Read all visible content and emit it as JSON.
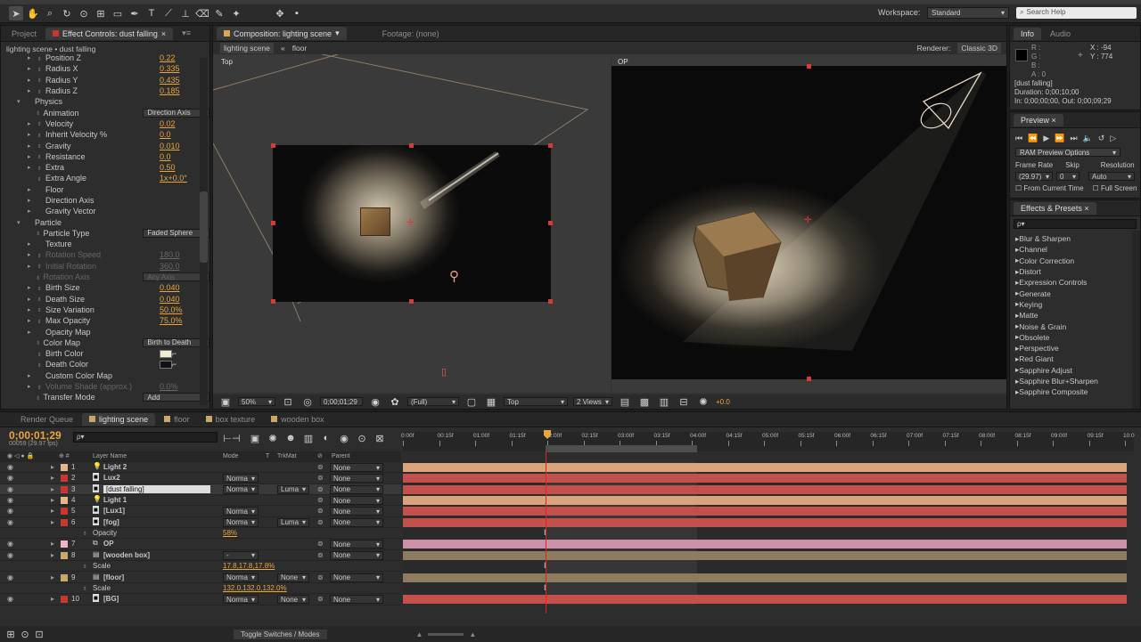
{
  "toolbar": {
    "workspace_label": "Workspace:",
    "workspace_value": "Standard",
    "search_placeholder": "Search Help"
  },
  "effect_controls": {
    "tab_project": "Project",
    "tab_effect": "Effect Controls: dust falling",
    "breadcrumb": "lighting scene • dust falling",
    "rows": [
      {
        "indent": 2,
        "tw": "▸",
        "sw": "♁",
        "name": "Position Z",
        "value": "0.22",
        "dim": false
      },
      {
        "indent": 2,
        "tw": "▸",
        "sw": "♁",
        "name": "Radius X",
        "value": "0.335",
        "dim": false
      },
      {
        "indent": 2,
        "tw": "▸",
        "sw": "♁",
        "name": "Radius Y",
        "value": "0.435",
        "dim": false
      },
      {
        "indent": 2,
        "tw": "▸",
        "sw": "♁",
        "name": "Radius Z",
        "value": "0.185",
        "dim": false
      },
      {
        "indent": 1,
        "tw": "▾",
        "sw": "",
        "name": "Physics",
        "value": "",
        "dim": false
      },
      {
        "indent": 2,
        "tw": "",
        "sw": "♁",
        "name": "Animation",
        "dd": "Direction Axis",
        "dim": false
      },
      {
        "indent": 2,
        "tw": "▸",
        "sw": "♁",
        "name": "Velocity",
        "value": "0.02",
        "dim": false
      },
      {
        "indent": 2,
        "tw": "▸",
        "sw": "♁",
        "name": "Inherit Velocity %",
        "value": "0.0",
        "dim": false
      },
      {
        "indent": 2,
        "tw": "▸",
        "sw": "♁",
        "name": "Gravity",
        "value": "0.010",
        "dim": false
      },
      {
        "indent": 2,
        "tw": "▸",
        "sw": "♁",
        "name": "Resistance",
        "value": "0.0",
        "dim": false
      },
      {
        "indent": 2,
        "tw": "▸",
        "sw": "♁",
        "name": "Extra",
        "value": "0.50",
        "dim": false
      },
      {
        "indent": 2,
        "tw": "",
        "sw": "♁",
        "name": "Extra Angle",
        "value": "1x+0.0°",
        "dim": false
      },
      {
        "indent": 2,
        "tw": "▸",
        "sw": "",
        "name": "Floor",
        "value": "",
        "dim": false
      },
      {
        "indent": 2,
        "tw": "▸",
        "sw": "",
        "name": "Direction Axis",
        "value": "",
        "dim": false
      },
      {
        "indent": 2,
        "tw": "▸",
        "sw": "",
        "name": "Gravity Vector",
        "value": "",
        "dim": false
      },
      {
        "indent": 1,
        "tw": "▾",
        "sw": "",
        "name": "Particle",
        "value": "",
        "dim": false
      },
      {
        "indent": 2,
        "tw": "",
        "sw": "♁",
        "name": "Particle Type",
        "dd": "Faded Sphere",
        "dim": false
      },
      {
        "indent": 2,
        "tw": "▸",
        "sw": "",
        "name": "Texture",
        "value": "",
        "dim": false
      },
      {
        "indent": 2,
        "tw": "▸",
        "sw": "♁",
        "name": "Rotation Speed",
        "value": "180.0",
        "dim": true
      },
      {
        "indent": 2,
        "tw": "▸",
        "sw": "♁",
        "name": "Initial Rotation",
        "value": "360.0",
        "dim": true
      },
      {
        "indent": 2,
        "tw": "",
        "sw": "♁",
        "name": "Rotation Axis",
        "dd": "Any Axis",
        "dim": true
      },
      {
        "indent": 2,
        "tw": "▸",
        "sw": "♁",
        "name": "Birth Size",
        "value": "0.040",
        "dim": false
      },
      {
        "indent": 2,
        "tw": "▸",
        "sw": "♁",
        "name": "Death Size",
        "value": "0.040",
        "dim": false
      },
      {
        "indent": 2,
        "tw": "▸",
        "sw": "♁",
        "name": "Size Variation",
        "value": "50.0%",
        "dim": false
      },
      {
        "indent": 2,
        "tw": "▸",
        "sw": "♁",
        "name": "Max Opacity",
        "value": "75.0%",
        "dim": false
      },
      {
        "indent": 2,
        "tw": "▸",
        "sw": "",
        "name": "Opacity Map",
        "value": "",
        "dim": false
      },
      {
        "indent": 2,
        "tw": "",
        "sw": "♁",
        "name": "Color Map",
        "dd": "Birth to Death",
        "dim": false
      },
      {
        "indent": 2,
        "tw": "",
        "sw": "♁",
        "name": "Birth Color",
        "swatch": "#f2ecd0",
        "dim": false
      },
      {
        "indent": 2,
        "tw": "",
        "sw": "♁",
        "name": "Death Color",
        "swatch": "#111111",
        "dim": false
      },
      {
        "indent": 2,
        "tw": "▸",
        "sw": "",
        "name": "Custom Color Map",
        "value": "",
        "dim": false
      },
      {
        "indent": 2,
        "tw": "▸",
        "sw": "♁",
        "name": "Volume Shade (approx.)",
        "value": "0.0%",
        "dim": true
      },
      {
        "indent": 2,
        "tw": "",
        "sw": "♁",
        "name": "Transfer Mode",
        "dd": "Add",
        "dim": false
      },
      {
        "indent": 2,
        "tw": "",
        "sw": "",
        "name": "",
        "value": "",
        "dim": false
      },
      {
        "indent": 1,
        "tw": "▸",
        "sw": "",
        "name": "Extras",
        "value": "",
        "dim": false
      }
    ]
  },
  "composition": {
    "tab_label": "Composition: lighting scene",
    "footage_label": "Footage: (none)",
    "breadcrumb_a": "lighting scene",
    "breadcrumb_b": "floor",
    "renderer_label": "Renderer:",
    "renderer_value": "Classic 3D",
    "view_left": "Top",
    "view_right": "OP",
    "footer": {
      "zoom": "50%",
      "timecode": "0;00;01;29",
      "resolution": "(Full)",
      "view": "Top",
      "views": "2 Views",
      "exposure": "+0.0"
    }
  },
  "info_panel": {
    "tab_info": "Info",
    "tab_audio": "Audio",
    "r": "R :",
    "g": "G :",
    "b": "B :",
    "a": "A : 0",
    "x": "X : -94",
    "y": "Y : 774",
    "layer": "[dust falling]",
    "duration": "Duration: 0;00;10;00",
    "inout": "In: 0;00;00;00, Out: 0;00;09;29"
  },
  "preview_panel": {
    "tab": "Preview",
    "ram_options": "RAM Preview Options",
    "frame_rate_label": "Frame Rate",
    "skip_label": "Skip",
    "resolution_label": "Resolution",
    "frame_rate": "(29.97)",
    "skip": "0",
    "resolution": "Auto",
    "from_current": "From Current Time",
    "full_screen": "Full Screen"
  },
  "effects_panel": {
    "tab": "Effects & Presets",
    "search_placeholder": "ρ▾",
    "items": [
      "Blur & Sharpen",
      "Channel",
      "Color Correction",
      "Distort",
      "Expression Controls",
      "Generate",
      "Keying",
      "Matte",
      "Noise & Grain",
      "Obsolete",
      "Perspective",
      "Red Giant",
      "Sapphire Adjust",
      "Sapphire Blur+Sharpen",
      "Sapphire Composite"
    ]
  },
  "timeline": {
    "tabs": [
      "Render Queue",
      "lighting scene",
      "floor",
      "box texture",
      "wooden box"
    ],
    "timecode": "0;00;01;29",
    "fps": "00059 (29.97 fps)",
    "search_placeholder": "ρ▾",
    "col_layer": "Layer Name",
    "col_mode": "Mode",
    "col_t": "T",
    "col_trkmat": "TrkMat",
    "col_parent": "Parent",
    "ruler": [
      "0:00f",
      "00:15f",
      "01:00f",
      "01:15f",
      "02:00f",
      "02:15f",
      "03:00f",
      "03:15f",
      "04:00f",
      "04:15f",
      "05:00f",
      "05:15f",
      "06:00f",
      "06:15f",
      "07:00f",
      "07:15f",
      "08:00f",
      "08:15f",
      "09:00f",
      "09:15f",
      "10:0"
    ],
    "toggle_label": "Toggle Switches / Modes",
    "layers": [
      {
        "num": "1",
        "name": "Light 2",
        "label": "#e5b58c",
        "type": "light",
        "bold": true,
        "mode": "",
        "trk": "",
        "parent": "None",
        "bar": "#d9a47c",
        "sub": ""
      },
      {
        "num": "2",
        "name": "Lux2",
        "label": "#c7372f",
        "type": "solid",
        "bold": true,
        "mode": "Norma",
        "trk": "",
        "parent": "None",
        "bar": "#c4504c",
        "sub": ""
      },
      {
        "num": "3",
        "name": "[dust falling]",
        "label": "#c7372f",
        "type": "solid",
        "bold": false,
        "mode": "Norma",
        "trk": "Luma",
        "parent": "None",
        "bar": "#c4504c",
        "sub": "",
        "selected": true
      },
      {
        "num": "4",
        "name": "Light 1",
        "label": "#e5b58c",
        "type": "light",
        "bold": true,
        "mode": "",
        "trk": "",
        "parent": "None",
        "bar": "#d9a47c",
        "sub": ""
      },
      {
        "num": "5",
        "name": "[Lux1]",
        "label": "#c7372f",
        "type": "solid",
        "bold": true,
        "mode": "Norma",
        "trk": "",
        "parent": "None",
        "bar": "#c4504c",
        "sub": ""
      },
      {
        "num": "6",
        "name": "[fog]",
        "label": "#c7372f",
        "type": "solid",
        "bold": true,
        "mode": "Norma",
        "trk": "Luma",
        "parent": "None",
        "bar": "#c4504c",
        "sub": ""
      },
      {
        "num": "",
        "name": "Opacity",
        "label": "",
        "type": "prop",
        "bold": false,
        "mode": "58%",
        "trk": "",
        "parent": "",
        "bar": "",
        "sub": "prop"
      },
      {
        "num": "7",
        "name": "OP",
        "label": "#f0b4c8",
        "type": "camera",
        "bold": true,
        "mode": "",
        "trk": "",
        "parent": "None",
        "bar": "#cc90a8",
        "sub": ""
      },
      {
        "num": "8",
        "name": "[wooden box]",
        "label": "#c9a86a",
        "type": "comp",
        "bold": true,
        "mode": "-",
        "trk": "",
        "parent": "None",
        "bar": "#8e7b60",
        "sub": ""
      },
      {
        "num": "",
        "name": "Scale",
        "label": "",
        "type": "prop",
        "bold": false,
        "mode": "17.8,17.8,17.8%",
        "trk": "",
        "parent": "",
        "bar": "",
        "sub": "prop"
      },
      {
        "num": "9",
        "name": "[floor]",
        "label": "#c9a86a",
        "type": "comp",
        "bold": true,
        "mode": "Norma",
        "trk": "None",
        "parent": "None",
        "bar": "#8e7b60",
        "sub": ""
      },
      {
        "num": "",
        "name": "Scale",
        "label": "",
        "type": "prop",
        "bold": false,
        "mode": "132.0,132.0,132.0%",
        "trk": "",
        "parent": "",
        "bar": "",
        "sub": "prop"
      },
      {
        "num": "10",
        "name": "[BG]",
        "label": "#c7372f",
        "type": "solid",
        "bold": true,
        "mode": "Norma",
        "trk": "None",
        "parent": "None",
        "bar": "#c4504c",
        "sub": ""
      }
    ]
  }
}
